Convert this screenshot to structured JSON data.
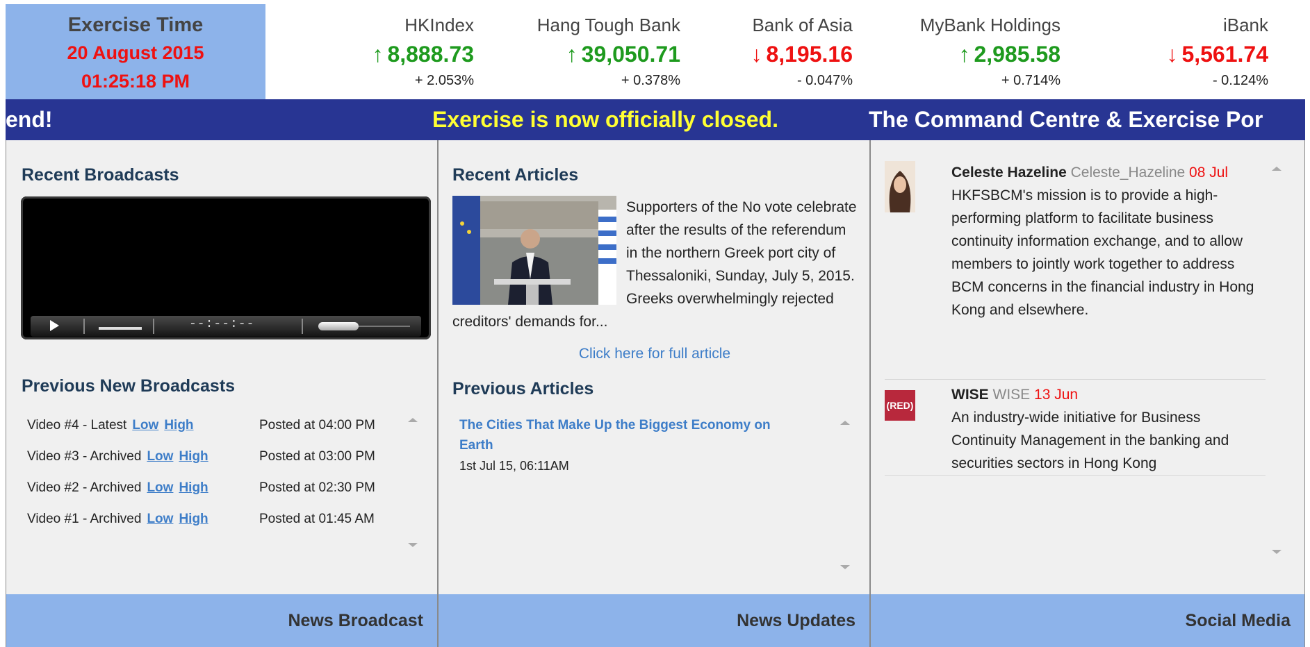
{
  "exercise": {
    "title": "Exercise Time",
    "date": "20 August 2015",
    "time": "01:25:18 PM"
  },
  "stocks": [
    {
      "name": "HKIndex",
      "arrow": "↑",
      "value": "8,888.73",
      "change": "+ 2.053%",
      "direction": "up"
    },
    {
      "name": "Hang Tough Bank",
      "arrow": "↑",
      "value": "39,050.71",
      "change": "+ 0.378%",
      "direction": "up"
    },
    {
      "name": "Bank of Asia",
      "arrow": "↓",
      "value": "8,195.16",
      "change": "- 0.047%",
      "direction": "down"
    },
    {
      "name": "MyBank Holdings",
      "arrow": "↑",
      "value": "2,985.58",
      "change": "+ 0.714%",
      "direction": "up"
    },
    {
      "name": "iBank",
      "arrow": "↓",
      "value": "5,561.74",
      "change": "- 0.124%",
      "direction": "down"
    }
  ],
  "marquee": {
    "segment_1": "end!",
    "segment_2": "Exercise is now officially closed.",
    "segment_3": "The Command Centre & Exercise Por"
  },
  "broadcasts": {
    "heading": "Recent Broadcasts",
    "video": {
      "time_code": "--:--:--"
    },
    "previous_heading": "Previous New Broadcasts",
    "items": [
      {
        "title": "Video #4 - Latest",
        "low": "Low",
        "high": "High",
        "posted": "Posted at 04:00 PM"
      },
      {
        "title": "Video #3 - Archived",
        "low": "Low",
        "high": "High",
        "posted": "Posted at 03:00 PM"
      },
      {
        "title": "Video #2 - Archived",
        "low": "Low",
        "high": "High",
        "posted": "Posted at 02:30 PM"
      },
      {
        "title": "Video #1 - Archived",
        "low": "Low",
        "high": "High",
        "posted": "Posted at 01:45 AM"
      }
    ],
    "footer": "News Broadcast"
  },
  "articles": {
    "heading": "Recent Articles",
    "summary": "Supporters of the No vote celebrate after the results of the referendum in the northern Greek port city of Thessaloniki, Sunday, July 5, 2015. Greeks overwhelmingly rejected creditors' demands for...",
    "full_link": "Click here for full article",
    "previous_heading": "Previous Articles",
    "previous": [
      {
        "title": "The Cities That Make Up the Biggest Economy on Earth",
        "date": "1st Jul 15, 06:11AM"
      }
    ],
    "footer": "News Updates"
  },
  "social": {
    "posts": [
      {
        "name": "Celeste Hazeline",
        "handle": "Celeste_Hazeline",
        "date": "08 Jul",
        "text": "HKFSBCM's mission is to provide a high-performing platform to facilitate business continuity information exchange, and to allow members to jointly work together to address BCM concerns in the financial industry in Hong Kong and elsewhere."
      },
      {
        "name": "WISE",
        "handle": "WISE",
        "date": "13 Jun",
        "avatar_text": "(RED)",
        "text": "An industry-wide initiative for Business Continuity Management in the banking and securities sectors in Hong Kong"
      }
    ],
    "footer": "Social Media"
  },
  "colors": {
    "header_blue": "#8db3ea",
    "marquee_navy": "#283593",
    "marquee_highlight": "#ffff33",
    "up_green": "#1e9a1e",
    "down_red": "#ee1111",
    "link_blue": "#3d7dc8"
  }
}
